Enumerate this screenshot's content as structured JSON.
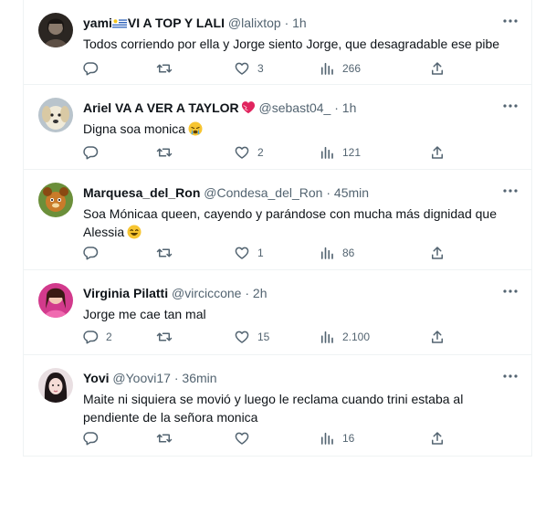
{
  "tweets": [
    {
      "display_name": "yami",
      "display_name_suffix": "VI A TOP Y LALI",
      "handle": "@lalixtop",
      "separator": "·",
      "time": "1h",
      "text": "Todos corriendo por ella y Jorge siento Jorge, que desagradable ese pibe",
      "reply_count": "",
      "retweet_count": "",
      "like_count": "3",
      "view_count": "266"
    },
    {
      "display_name": "Ariel VA A VER A TAYLOR",
      "handle": "@sebast04_",
      "separator": "·",
      "time": "1h",
      "text": "Digna soa monica",
      "reply_count": "",
      "retweet_count": "",
      "like_count": "2",
      "view_count": "121"
    },
    {
      "display_name": "Marquesa_del_Ron",
      "handle": "@Condesa_del_Ron",
      "separator": "·",
      "time": "45min",
      "text": "Soa Mónicaa queen, cayendo y parándose con mucha más dignidad que Alessia",
      "reply_count": "",
      "retweet_count": "",
      "like_count": "1",
      "view_count": "86"
    },
    {
      "display_name": "Virginia Pilatti",
      "handle": "@virciccone",
      "separator": "·",
      "time": "2h",
      "text": "Jorge me cae tan mal",
      "reply_count": "2",
      "retweet_count": "",
      "like_count": "15",
      "view_count": "2.100"
    },
    {
      "display_name": "Yovi",
      "handle": "@Yoovi17",
      "separator": "·",
      "time": "36min",
      "text": "Maite ni siquiera se movió y luego le reclama cuando trini estaba al pendiente de la señora monica",
      "reply_count": "",
      "retweet_count": "",
      "like_count": "",
      "view_count": "16"
    }
  ],
  "colors": {
    "text": "#0f1419",
    "secondary": "#536471",
    "border": "#eff3f4"
  },
  "icons": [
    "avatar",
    "flag-uruguay-icon",
    "heart-emoji-icon",
    "crying-emoji-icon",
    "grinning-emoji-icon",
    "more-icon",
    "reply-icon",
    "retweet-icon",
    "like-icon",
    "views-icon",
    "share-icon"
  ]
}
